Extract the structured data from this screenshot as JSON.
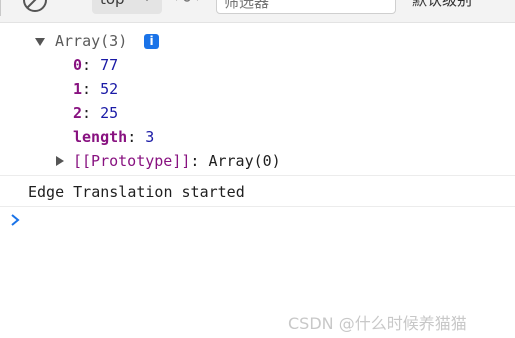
{
  "toolbar": {
    "context_label": "top",
    "filter_placeholder": "筛选器",
    "levels_label": "默认级别"
  },
  "console": {
    "array_summary": "Array(3)",
    "info_badge": "i",
    "items": [
      {
        "key": "0",
        "sep": ": ",
        "value": "77"
      },
      {
        "key": "1",
        "sep": ": ",
        "value": "52"
      },
      {
        "key": "2",
        "sep": ": ",
        "value": "25"
      }
    ],
    "length_key": "length",
    "length_sep": ": ",
    "length_value": "3",
    "prototype_key": "[[Prototype]]",
    "prototype_sep": ": ",
    "prototype_value": "Array(0)",
    "message": "Edge Translation started",
    "prompt_symbol": "›"
  },
  "watermark": "CSDN @什么时候养猫猫",
  "colors": {
    "key": "#881280",
    "number": "#1a1aa6",
    "info_badge": "#1a73e8",
    "prompt": "#1a73e8"
  },
  "icons": [
    "clear-console-icon",
    "chevron-down-icon",
    "eye-icon",
    "triangle-down-icon",
    "triangle-right-icon",
    "info-icon",
    "prompt-chevron-icon"
  ]
}
